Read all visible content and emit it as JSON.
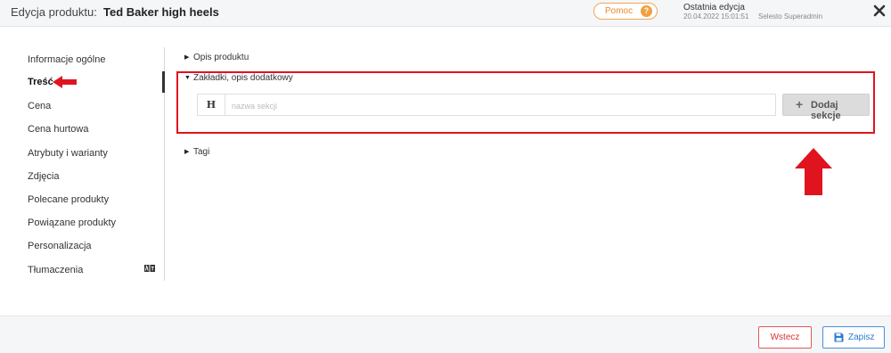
{
  "header": {
    "label": "Edycja produktu:",
    "product_name": "Ted Baker high heels",
    "help_label": "Pomoc",
    "help_icon": "?",
    "last_edit_title": "Ostatnia edycja",
    "last_edit_date": "20.04.2022  15:01:51",
    "last_edit_user": "Selesto Superadmin"
  },
  "sidebar": {
    "items": [
      {
        "label": "Informacje ogólne"
      },
      {
        "label": "Treść"
      },
      {
        "label": "Cena"
      },
      {
        "label": "Cena hurtowa"
      },
      {
        "label": "Atrybuty i warianty"
      },
      {
        "label": "Zdjęcia"
      },
      {
        "label": "Polecane produkty"
      },
      {
        "label": "Powiązane produkty"
      },
      {
        "label": "Personalizacja"
      },
      {
        "label": "Tłumaczenia"
      }
    ],
    "active": "Treść"
  },
  "main": {
    "sections": [
      {
        "label": "Opis produktu",
        "expanded": false
      },
      {
        "label": "Zakładki, opis dodatkowy",
        "expanded": true
      },
      {
        "label": "Tagi",
        "expanded": false
      }
    ],
    "heading_prefix": "H",
    "section_name_placeholder": "nazwa sekcji",
    "section_name_value": "",
    "add_section_label": "Dodaj sekcje",
    "add_section_icon": "+"
  },
  "footer": {
    "back_label": "Wstecz",
    "save_label": "Zapisz"
  },
  "colors": {
    "annotation_red": "#e0141e",
    "help_orange": "#f0a040",
    "save_blue": "#2d7bd4"
  }
}
